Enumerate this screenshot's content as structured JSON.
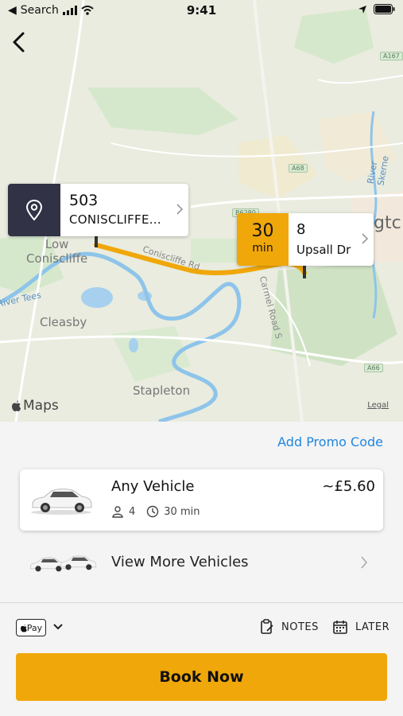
{
  "status_bar": {
    "back_app": "Search",
    "time": "9:41"
  },
  "map": {
    "places": {
      "low_coniscliffe": "Low\nConiscliffe",
      "cleasby": "Cleasby",
      "stapleton": "Stapleton",
      "gtc": "gtc"
    },
    "road_tags": [
      "A167",
      "A68",
      "B6280",
      "A66"
    ],
    "road_names": {
      "coniscliffe_rd": "Coniscliffe Rd",
      "carmel_road": "Carmel Road S"
    },
    "river_names": {
      "tees": "River Tees",
      "skerne": "River Skerne"
    },
    "attribution": "Maps",
    "legal": "Legal"
  },
  "pickup": {
    "number": "503",
    "street": "CONISCLIFFE..."
  },
  "destination": {
    "eta_value": "30",
    "eta_unit": "min",
    "number": "8",
    "street": "Upsall Dr"
  },
  "panel": {
    "promo_label": "Add Promo Code",
    "vehicle": {
      "name": "Any Vehicle",
      "price": "~£5.60",
      "passengers": "4",
      "duration": "30 min"
    },
    "more_vehicles_label": "View More Vehicles",
    "payment_label": "Pay",
    "notes_label": "NOTES",
    "later_label": "LATER",
    "book_label": "Book Now"
  },
  "colors": {
    "accent": "#f0a70a",
    "link": "#1f86e0",
    "pickup_box": "#323246"
  }
}
